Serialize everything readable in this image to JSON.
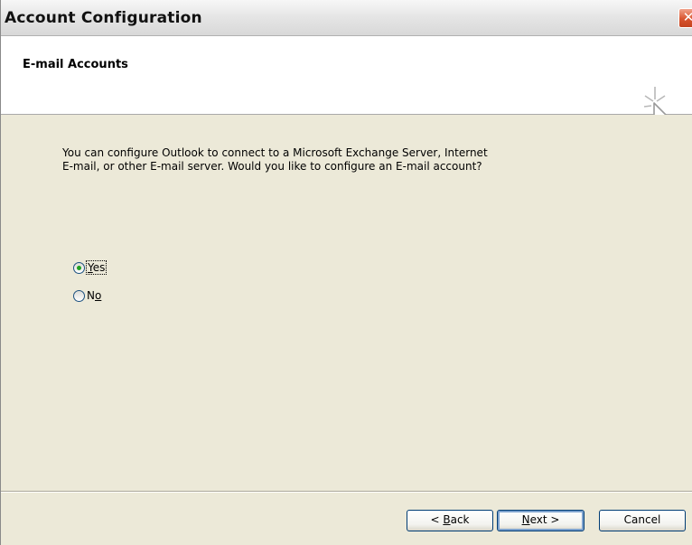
{
  "window": {
    "title": "Account Configuration"
  },
  "header": {
    "title": "E-mail Accounts",
    "icon": "wizard-cursor-icon"
  },
  "main": {
    "description_line1": "You can configure Outlook to connect to a Microsoft Exchange Server, Internet",
    "description_line2": "E-mail, or other E-mail server.  Would you like to configure an E-mail account?",
    "options": [
      {
        "label_pre": "",
        "label_access": "Y",
        "label_post": "es",
        "selected": true
      },
      {
        "label_pre": "N",
        "label_access": "o",
        "label_post": "",
        "selected": false
      }
    ]
  },
  "footer": {
    "back_pre": "< ",
    "back_access": "B",
    "back_post": "ack",
    "next_pre": "",
    "next_access": "N",
    "next_post": "ext >",
    "cancel_label": "Cancel"
  },
  "colors": {
    "dialog_bg": "#ece9d8",
    "header_bg": "#ffffff",
    "radio_dot": "#21a121",
    "button_border": "#003c74",
    "close_button": "#d8542f"
  }
}
